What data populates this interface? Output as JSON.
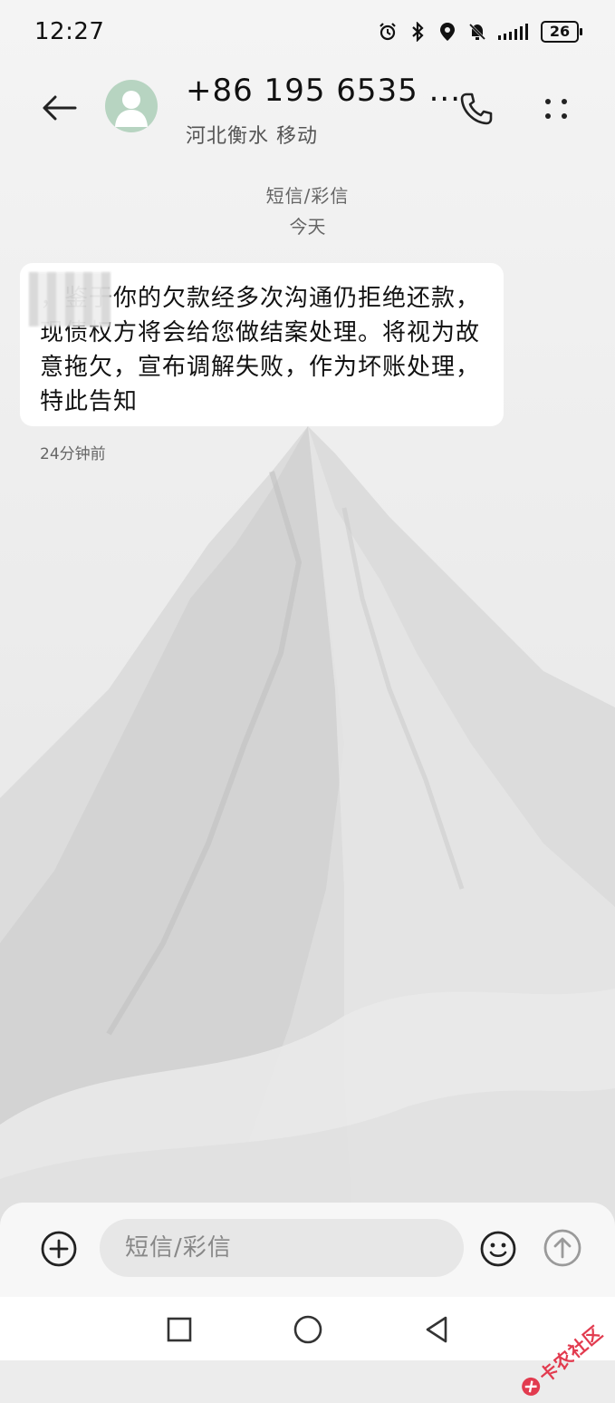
{
  "status_bar": {
    "time": "12:27",
    "battery": "26",
    "icons": [
      "alarm-icon",
      "bluetooth-icon",
      "location-icon",
      "mute-bell-icon",
      "signal-icon",
      "battery-icon"
    ]
  },
  "header": {
    "contact_name": "+86 195 6535 ...",
    "contact_location": "河北衡水 移动",
    "back_icon": "back-arrow-icon",
    "call_icon": "phone-icon",
    "more_icon": "more-vertical-icon"
  },
  "thread": {
    "message_type": "短信/彩信",
    "day_label": "今天",
    "messages": [
      {
        "text": "  ，鉴于你的欠款经多次沟通仍拒绝还款，现债权方将会给您做结案处理。将视为故意拖欠，宣布调解失败，作为坏账处理，特此告知",
        "time": "24分钟前"
      }
    ]
  },
  "composer": {
    "placeholder": "短信/彩信",
    "add_icon": "add-circle-icon",
    "emoji_icon": "emoji-icon",
    "send_icon": "send-arrow-icon"
  },
  "navigation": {
    "buttons": [
      "recents-square-icon",
      "home-circle-icon",
      "back-triangle-icon"
    ]
  },
  "watermark": {
    "text": "卡农社区"
  },
  "colors": {
    "avatar_bg": "#b7d4c1",
    "bubble_bg": "#ffffff",
    "watermark": "#e23b4f"
  }
}
